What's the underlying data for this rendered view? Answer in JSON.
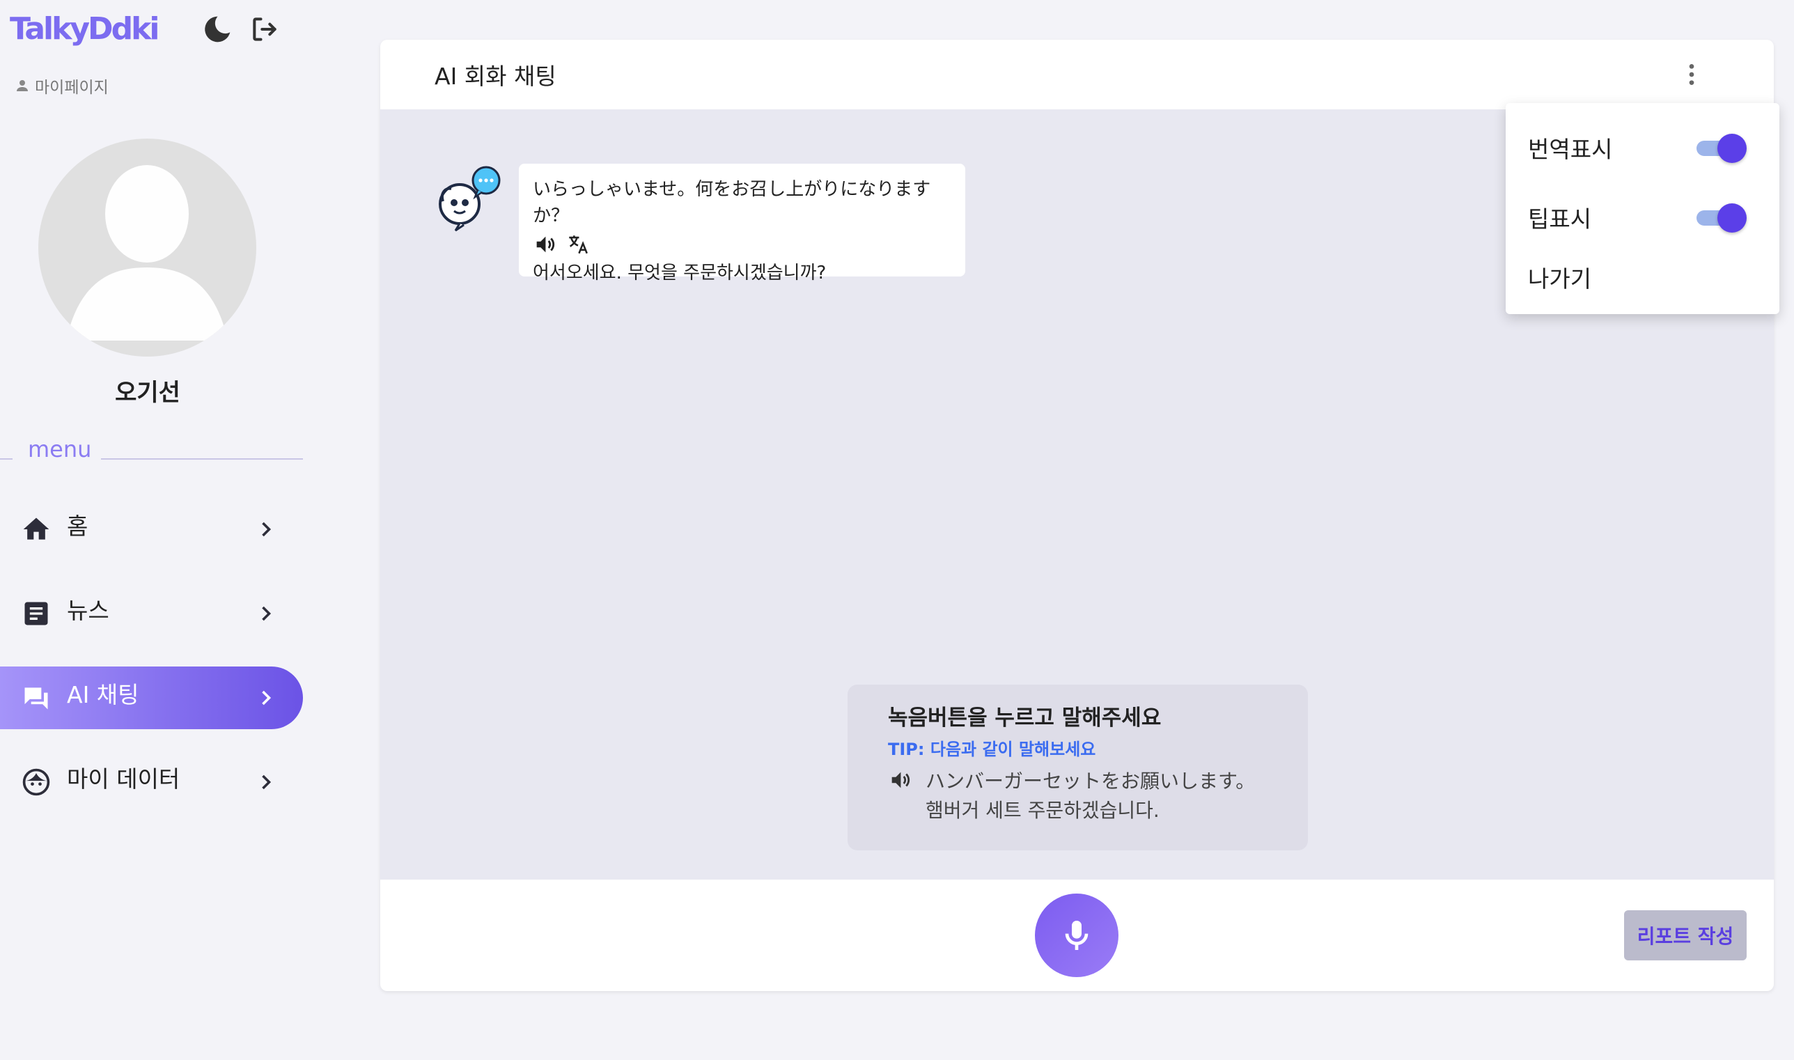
{
  "app": {
    "logo": "TalkyDdki"
  },
  "sidebar": {
    "mypage_label": "마이페이지",
    "username": "오기선",
    "menu_label": "menu",
    "items": [
      {
        "label": "홈",
        "icon": "home-icon",
        "active": false
      },
      {
        "label": "뉴스",
        "icon": "article-icon",
        "active": false
      },
      {
        "label": "AI 채팅",
        "icon": "chat-icon",
        "active": true
      },
      {
        "label": "마이 데이터",
        "icon": "face-icon",
        "active": false
      }
    ]
  },
  "main": {
    "title": "AI 회화 채팅",
    "message": {
      "japanese": "いらっしゃいませ。何をお召し上がりになりますか？",
      "korean": "어서오세요. 무엇을 주문하시겠습니까?"
    },
    "tip": {
      "title": "녹음버튼을 누르고 말해주세요",
      "subtitle": "TIP: 다음과 같이 말해보세요",
      "japanese": "ハンバーガーセットをお願いします。",
      "korean": "햄버거 세트 주문하겠습니다."
    },
    "report_label": "리포트 작성"
  },
  "dropdown": {
    "items": [
      {
        "label": "번역표시",
        "toggle": true
      },
      {
        "label": "팁표시",
        "toggle": true
      },
      {
        "label": "나가기"
      }
    ]
  },
  "colors": {
    "accent": "#6b53e6",
    "accent_light": "#a594f9",
    "tip_blue": "#3b6cf0",
    "toggle_track": "#9cb4ea"
  }
}
